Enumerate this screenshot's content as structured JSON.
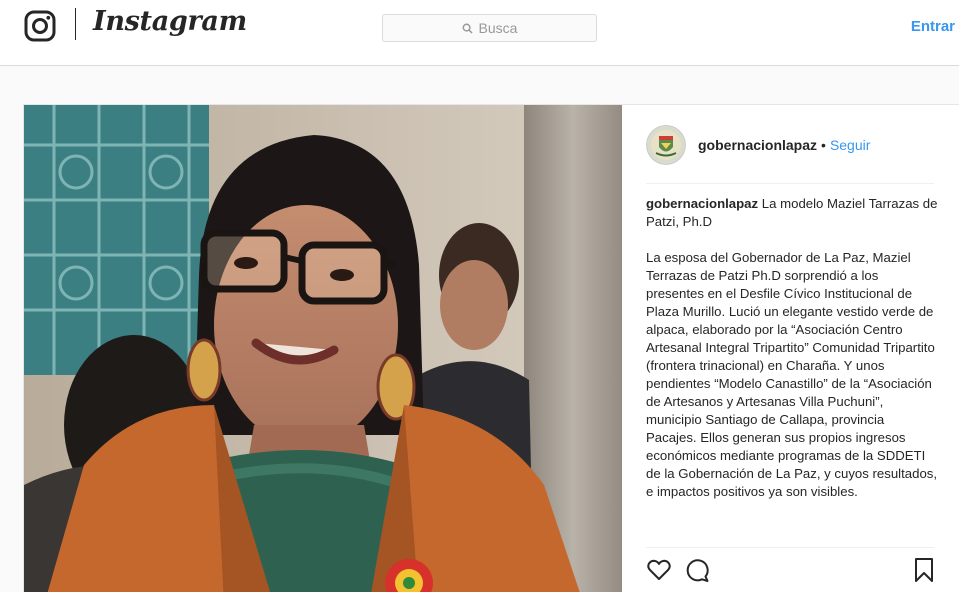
{
  "nav": {
    "brand": "Instagram",
    "search_placeholder": "Busca",
    "login_label": "Entrar"
  },
  "post": {
    "username": "gobernacionlapaz",
    "follow_separator": "•",
    "follow_label": "Seguir",
    "caption_title": "La modelo Maziel Tarrazas de Patzi, Ph.D",
    "caption_body": "La esposa del Gobernador de La Paz, Maziel Terrazas de Patzi Ph.D sorprendió a los presentes en el Desfile Cívico Institucional de Plaza Murillo. Lució un elegante vestido verde de alpaca, elaborado por la “Asociación Centro Artesanal Integral Tripartito” Comunidad Tripartito (frontera trinacional) en Charaña. Y unos pendientes “Modelo Canastillo” de la “Asociación de Artesanos y Artesanas Villa Puchuni”, municipio Santiago de Callapa, provincia Pacajes. Ellos generan sus propios ingresos económicos mediante programas de la SDDETI de la Gobernación de La Paz, y cuyos resultados, e impactos positivos ya son visibles."
  },
  "icons": {
    "logo": "instagram-camera-icon",
    "search": "search-icon",
    "like": "heart-icon",
    "comment": "comment-bubble-icon",
    "save": "bookmark-icon"
  },
  "colors": {
    "link": "#3897f0",
    "text": "#262626",
    "border": "#dbdbdb",
    "background": "#fafafa"
  }
}
